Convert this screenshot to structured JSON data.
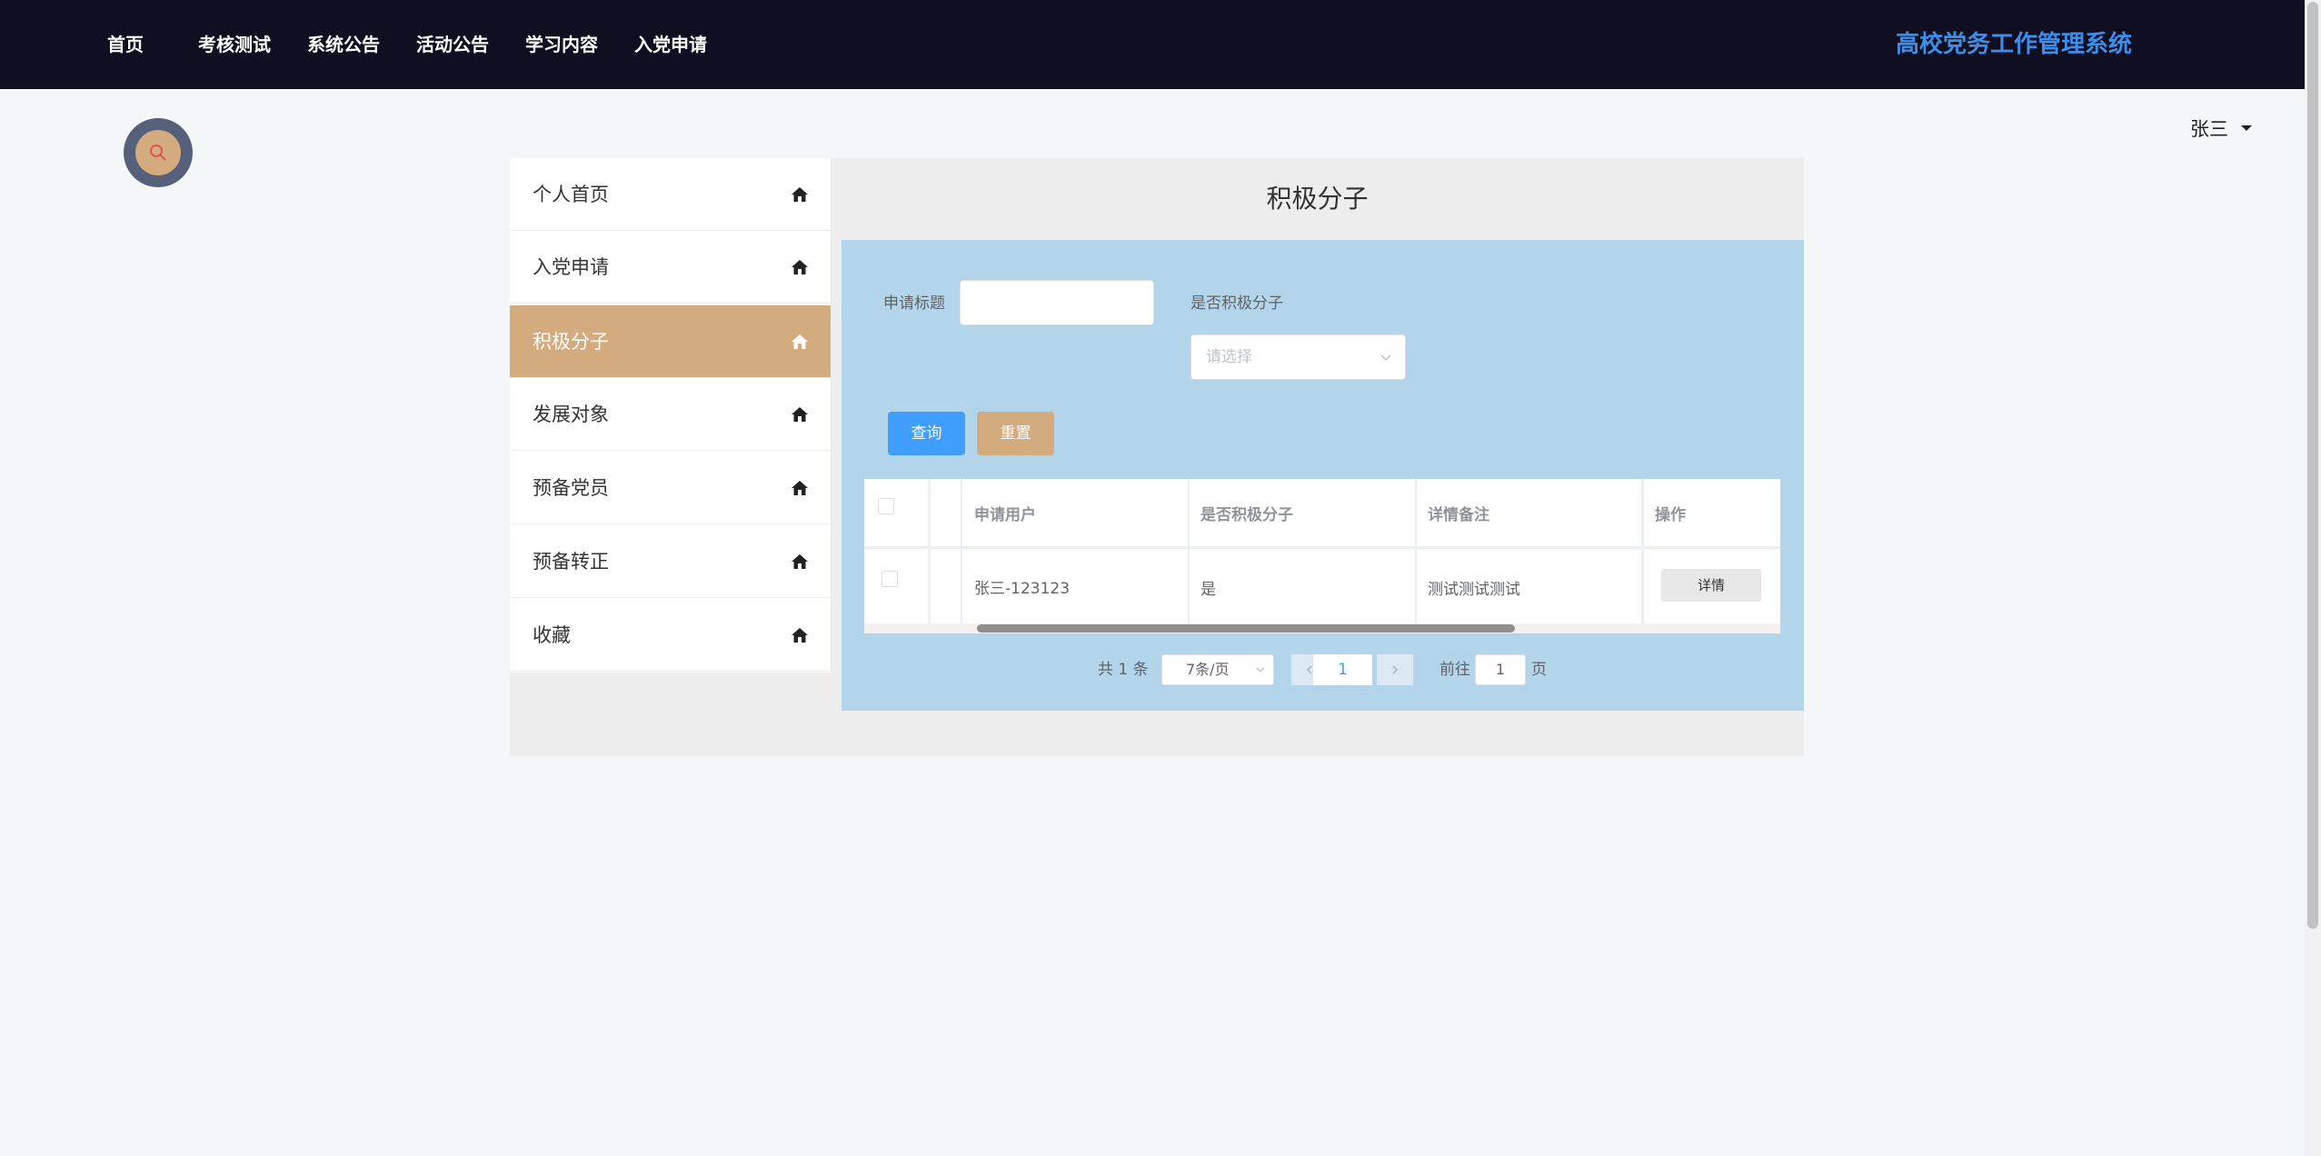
{
  "nav": {
    "items": [
      "首页",
      "考核测试",
      "系统公告",
      "活动公告",
      "学习内容",
      "入党申请"
    ],
    "brand": "高校党务工作管理系统"
  },
  "user": {
    "name": "张三"
  },
  "sidebar": {
    "items": [
      {
        "label": "个人首页",
        "icon": "home-icon"
      },
      {
        "label": "入党申请",
        "icon": "home-icon"
      },
      {
        "label": "积极分子",
        "icon": "home-icon",
        "active": true
      },
      {
        "label": "发展对象",
        "icon": "home-icon"
      },
      {
        "label": "预备党员",
        "icon": "home-icon"
      },
      {
        "label": "预备转正",
        "icon": "home-icon"
      },
      {
        "label": "收藏",
        "icon": "home-icon"
      }
    ]
  },
  "page": {
    "title": "积极分子"
  },
  "filters": {
    "title_label": "申请标题",
    "title_value": "",
    "active_label": "是否积极分子",
    "active_placeholder": "请选择",
    "query_label": "查询",
    "reset_label": "重置"
  },
  "table": {
    "headers": [
      "申请用户",
      "是否积极分子",
      "详情备注",
      "操作"
    ],
    "rows": [
      {
        "user": "张三-123123",
        "is_active": "是",
        "remark": "测试测试测试",
        "action": "详情"
      }
    ]
  },
  "pagination": {
    "total_text": "共 1 条",
    "page_size": "7条/页",
    "current_page": "1",
    "goto_label": "前往",
    "goto_value": "1",
    "page_suffix": "页"
  },
  "colors": {
    "topbar": "#0f0f21",
    "brand": "#3d8ee8",
    "accent": "#d4aa7f",
    "panel": "#b3d5ea",
    "primary": "#409eff"
  }
}
